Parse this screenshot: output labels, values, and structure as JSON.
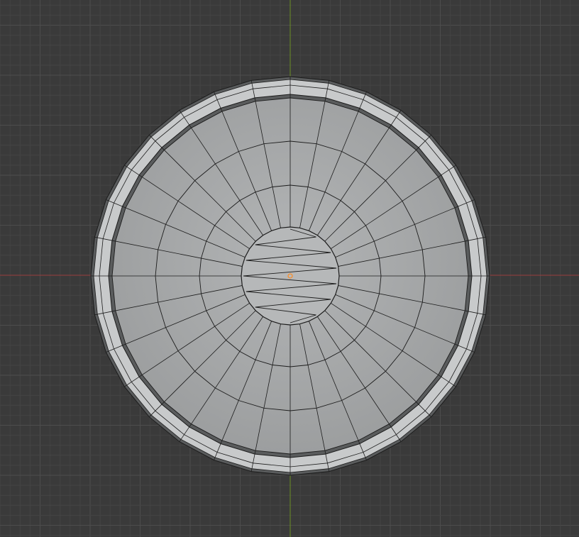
{
  "viewport": {
    "view": "top-orthographic",
    "background_color": "#3a3a3a",
    "grid_minor_color": "#444444",
    "grid_major_color": "#4d4d4d",
    "axis_x_color": "#9a3d3d",
    "axis_y_color": "#6a8e23",
    "origin_color": "#ff8a1e"
  },
  "object": {
    "type": "mesh",
    "shape": "cylindrical-cup",
    "display": "wireframe-overlay",
    "radial_segments": 32,
    "selected": false
  },
  "colors": {
    "mesh_face": "#a8aaab",
    "mesh_rim_light": "#c8cacb",
    "mesh_rim_dark": "#5a5c5d",
    "wire": "#1c1c1c"
  }
}
